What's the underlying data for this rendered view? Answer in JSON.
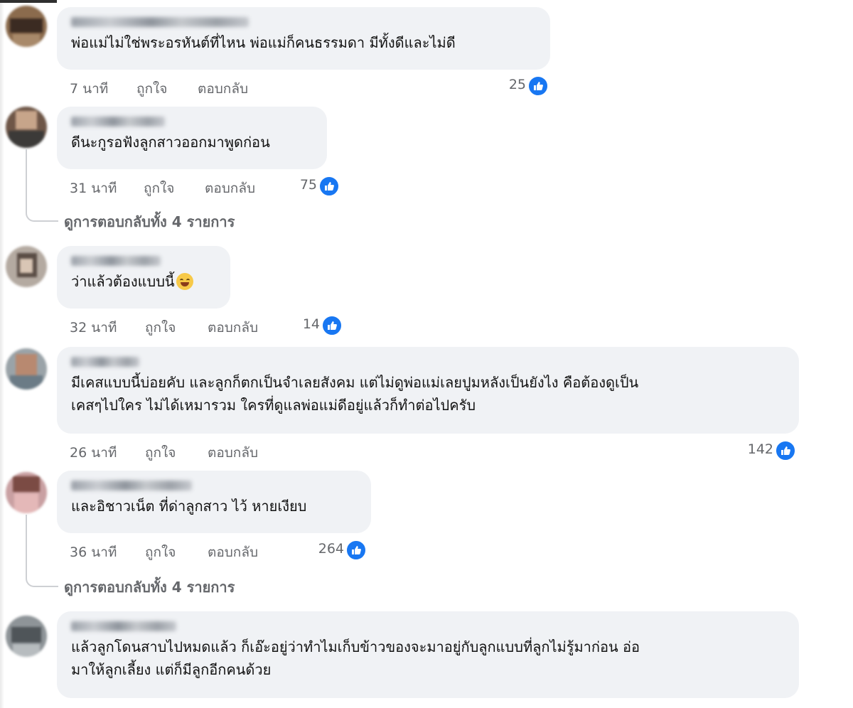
{
  "colors": {
    "bubble": "#f0f2f5",
    "meta_text": "#65676b",
    "like_blue": "#1877f2"
  },
  "comments": [
    {
      "text": [
        "พ่อแม่ไม่ใช่พระอรหันต์ที่ไหน พ่อแม่ก็คนธรรมดา มีทั้งดีและไม่ดี"
      ],
      "time": "7 นาที",
      "like": "ถูกใจ",
      "reply": "ตอบกลับ",
      "reactions": "25"
    },
    {
      "text": [
        "ดีนะกูรอฟังลูกสาวออกมาพูดก่อน"
      ],
      "time": "31 นาที",
      "like": "ถูกใจ",
      "reply": "ตอบกลับ",
      "reactions": "75",
      "view_replies": "ดูการตอบกลับทั้ง 4 รายการ"
    },
    {
      "text": [
        "ว่าแล้วต้องแบบนี้"
      ],
      "emoji": "grinning-emoji",
      "time": "32 นาที",
      "like": "ถูกใจ",
      "reply": "ตอบกลับ",
      "reactions": "14"
    },
    {
      "text": [
        "มีเคสแบบนี้บ่อยคับ และลูกก็ตกเป็นจำเลยสังคม แต่ไม่ดูพ่อแม่เลยปูมหลังเป็นยังไง คือต้องดูเป็น",
        "เคสๆไปใคร ไม่ได้เหมารวม ใครที่ดูแลพ่อแม่ดีอยู่แล้วก็ทำต่อไปครับ"
      ],
      "time": "26 นาที",
      "like": "ถูกใจ",
      "reply": "ตอบกลับ",
      "reactions": "142"
    },
    {
      "text": [
        "และอิชาวเน็ต ที่ด่าลูกสาว ไว้ หายเงียบ"
      ],
      "time": "36 นาที",
      "like": "ถูกใจ",
      "reply": "ตอบกลับ",
      "reactions": "264",
      "view_replies": "ดูการตอบกลับทั้ง 4 รายการ"
    },
    {
      "text": [
        "แล้วลูกโดนสาบไปหมดแล้ว ก็เอ๊ะอยู่ว่าทำไมเก็บข้าวของจะมาอยู่กับลูกแบบที่ลูกไม่รู้มาก่อน อ่อ",
        "มาให้ลูกเลี้ยง แต่ก็มีลูกอีกคนด้วย"
      ]
    }
  ]
}
